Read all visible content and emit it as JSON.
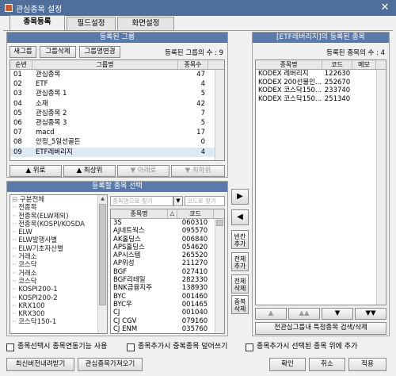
{
  "window": {
    "title": "관심종목 설정",
    "close": "✕"
  },
  "tabs": [
    {
      "label": "종목등록"
    },
    {
      "label": "필드설정"
    },
    {
      "label": "화면설정"
    }
  ],
  "groups": {
    "header": "등록된 그룹",
    "buttons": {
      "new": "새그룹",
      "delete": "그룹삭제",
      "rename": "그룹명변경"
    },
    "count_label": "등록된 그룹의 수 : 9",
    "columns": [
      "순번",
      "그룹명",
      "종목수"
    ],
    "rows": [
      {
        "no": "01",
        "name": "관심종목",
        "count": "47"
      },
      {
        "no": "02",
        "name": "ETF",
        "count": "4"
      },
      {
        "no": "03",
        "name": "관심종목 1",
        "count": "5"
      },
      {
        "no": "04",
        "name": "소재",
        "count": "42"
      },
      {
        "no": "05",
        "name": "관심종목 2",
        "count": "7"
      },
      {
        "no": "06",
        "name": "관심종목 3",
        "count": "5"
      },
      {
        "no": "07",
        "name": "macd",
        "count": "17"
      },
      {
        "no": "08",
        "name": "안정_5일선골든",
        "count": "0"
      },
      {
        "no": "09",
        "name": "ETF레버리지",
        "count": "4"
      }
    ],
    "move_buttons": {
      "up": "▲ 위로",
      "top": "▲ 최상위",
      "down": "▼ 아래로",
      "bottom": "▼ 최하위"
    }
  },
  "selection": {
    "header": "등록할 종목 선택",
    "tree": [
      "구분전체",
      "전종목",
      "전종목(ELW제외)",
      "전종목(KOSPI/KOSDA",
      "ELW",
      "ELW발행사별",
      "ELW기초자산별",
      "거래소",
      "코스닥",
      "거래소",
      "코스닥",
      "KOSPI200-1",
      "KOSPI200-2",
      "KRX100",
      "KRX300",
      "코스닥150-1"
    ],
    "search_placeholder": "종목명으로 찾기",
    "code_placeholder": "코드로 찾기",
    "columns": [
      "종목명",
      "코드"
    ],
    "rows": [
      {
        "name": "3S",
        "code": "060310"
      },
      {
        "name": "AJ네트웍스",
        "code": "095570"
      },
      {
        "name": "AK홀딩스",
        "code": "006840"
      },
      {
        "name": "APS홀딩스",
        "code": "054620"
      },
      {
        "name": "AP시스템",
        "code": "265520"
      },
      {
        "name": "AP위성",
        "code": "211270"
      },
      {
        "name": "BGF",
        "code": "027410"
      },
      {
        "name": "BGF리테일",
        "code": "282330"
      },
      {
        "name": "BNK금융지주",
        "code": "138930"
      },
      {
        "name": "BYC",
        "code": "001460"
      },
      {
        "name": "BYC우",
        "code": "001465"
      },
      {
        "name": "CJ",
        "code": "001040"
      },
      {
        "name": "CJ CGV",
        "code": "079160"
      },
      {
        "name": "CJ ENM",
        "code": "035760"
      }
    ]
  },
  "middle_buttons": {
    "right": "▶",
    "left": "◀",
    "blank_add": [
      "빈칸",
      "추가"
    ],
    "add_all": [
      "전체",
      "추가"
    ],
    "del_all": [
      "전체",
      "삭제"
    ],
    "dup_del": [
      "중복",
      "삭제"
    ]
  },
  "registered": {
    "header": "[ETF레버리지]의 등록된 종목",
    "count_label": "등록된 종목의 수 : 4",
    "columns": [
      "종목명",
      "코드",
      "메모"
    ],
    "rows": [
      {
        "name": "KODEX 레버리지",
        "code": "122630"
      },
      {
        "name": "KODEX 200선물인...",
        "code": "252670"
      },
      {
        "name": "KODEX 코스닥150...",
        "code": "233740"
      },
      {
        "name": "KODEX 코스닥150...",
        "code": "251340"
      }
    ],
    "move_buttons": [
      "▲",
      "▲▲",
      "▼",
      "▼▼"
    ],
    "search_button": "전관심그룹내 특정종목 검색/삭제"
  },
  "options": [
    "종목선택시 종목연동기능 사용",
    "종목추가시 중복종목 덮어쓰기",
    "종목추가시 선택된 종목 위에 추가"
  ],
  "bottom": {
    "latest": "최신버전내려받기",
    "import": "관심종목가져오기",
    "ok": "확인",
    "cancel": "취소",
    "apply": "적용"
  }
}
